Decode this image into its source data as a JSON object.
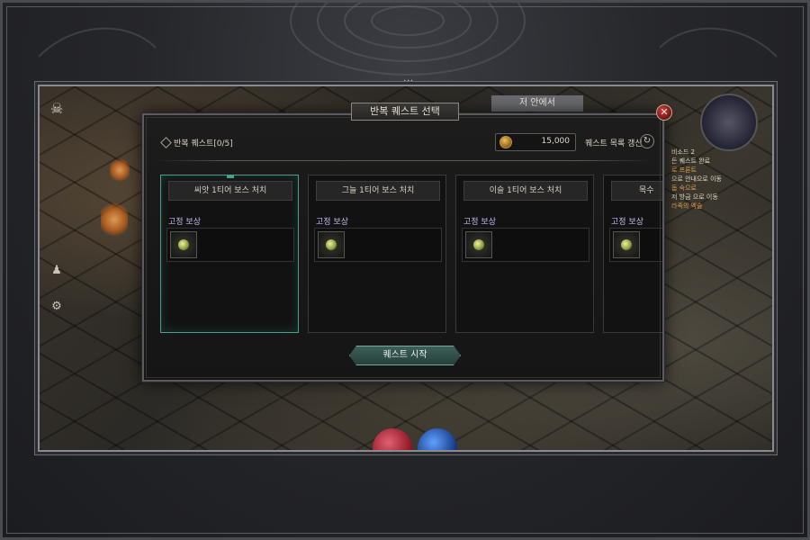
{
  "dialog": {
    "title": "반복 퀘스트 선택",
    "quest_count_label": "반복 퀘스트[0/5]",
    "currency_amount": "15,000",
    "refresh_label": "퀘스트 목록 갱신",
    "start_button": "퀘스트 시작",
    "close_icon": "close-icon"
  },
  "quests": [
    {
      "title": "씨앗 1티어 보스 처치",
      "reward_label": "고정 보상",
      "selected": true
    },
    {
      "title": "그늘 1티어 보스 처치",
      "reward_label": "고정 보상",
      "selected": false
    },
    {
      "title": "이슬 1티어 보스 처치",
      "reward_label": "고정 보상",
      "selected": false
    },
    {
      "title": "목수",
      "reward_label": "고정 보상",
      "selected": false
    }
  ],
  "hud": {
    "top_tab": "저 안에서",
    "log": [
      "비소드 2",
      "든 퀘스트 완료",
      "로 프론트",
      "으로 안내으로 이동",
      "돕 숙으로",
      "저 방금 으로 이동",
      "라족의 엑슬"
    ]
  },
  "colors": {
    "accent_teal": "#4d9d8a",
    "reward_label": "#c4b8f0",
    "close_red": "#d04040"
  }
}
